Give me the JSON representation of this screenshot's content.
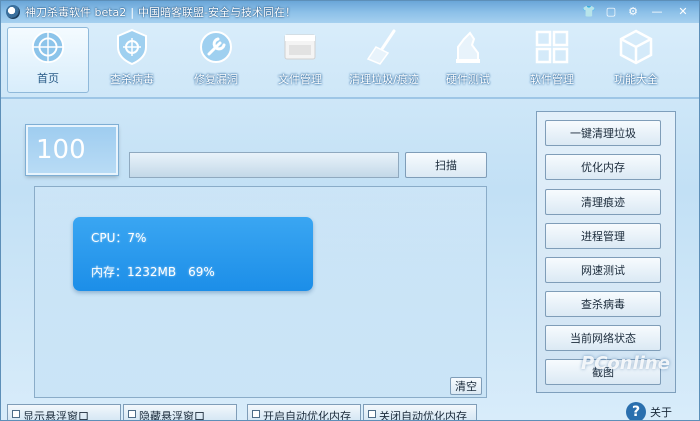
{
  "window": {
    "title_app": "神刀杀毒软件 beta2",
    "title_slogan": "中国暗客联盟-安全与技术同在！",
    "controls": [
      "👕",
      "▢",
      "⚙",
      "—",
      "✕"
    ]
  },
  "toolbar": {
    "items": [
      {
        "label": "首页",
        "icon": "home-icon",
        "active": true
      },
      {
        "label": "查杀病毒",
        "icon": "virus-scan-icon",
        "active": false
      },
      {
        "label": "修复漏洞",
        "icon": "repair-icon",
        "active": false
      },
      {
        "label": "文件管理",
        "icon": "file-manager-icon",
        "active": false
      },
      {
        "label": "清理垃圾/痕迹",
        "icon": "broom-icon",
        "active": false
      },
      {
        "label": "硬件测试",
        "icon": "hardware-test-icon",
        "active": false
      },
      {
        "label": "软件管理",
        "icon": "software-manager-icon",
        "active": false
      },
      {
        "label": "功能大全",
        "icon": "cube-icon",
        "active": false
      }
    ]
  },
  "main": {
    "score": "100",
    "progress": 0,
    "scan_label": "扫描",
    "clear_label": "清空",
    "cpu_line": "CPU：7%",
    "mem_line": "内存：1232MB　69%"
  },
  "side_buttons": [
    "一键清理垃圾",
    "优化内存",
    "清理痕迹",
    "进程管理",
    "网速测试",
    "查杀病毒",
    "当前网络状态",
    "截图"
  ],
  "bottom": {
    "buttons": [
      "显示悬浮窗口",
      "隐藏悬浮窗口",
      "开启自动优化内存",
      "关闭自动优化内存"
    ],
    "about_label": "关于"
  },
  "watermark": "PConline",
  "colors": {
    "accent": "#1c8ee8",
    "title": "#6aa6d8"
  }
}
